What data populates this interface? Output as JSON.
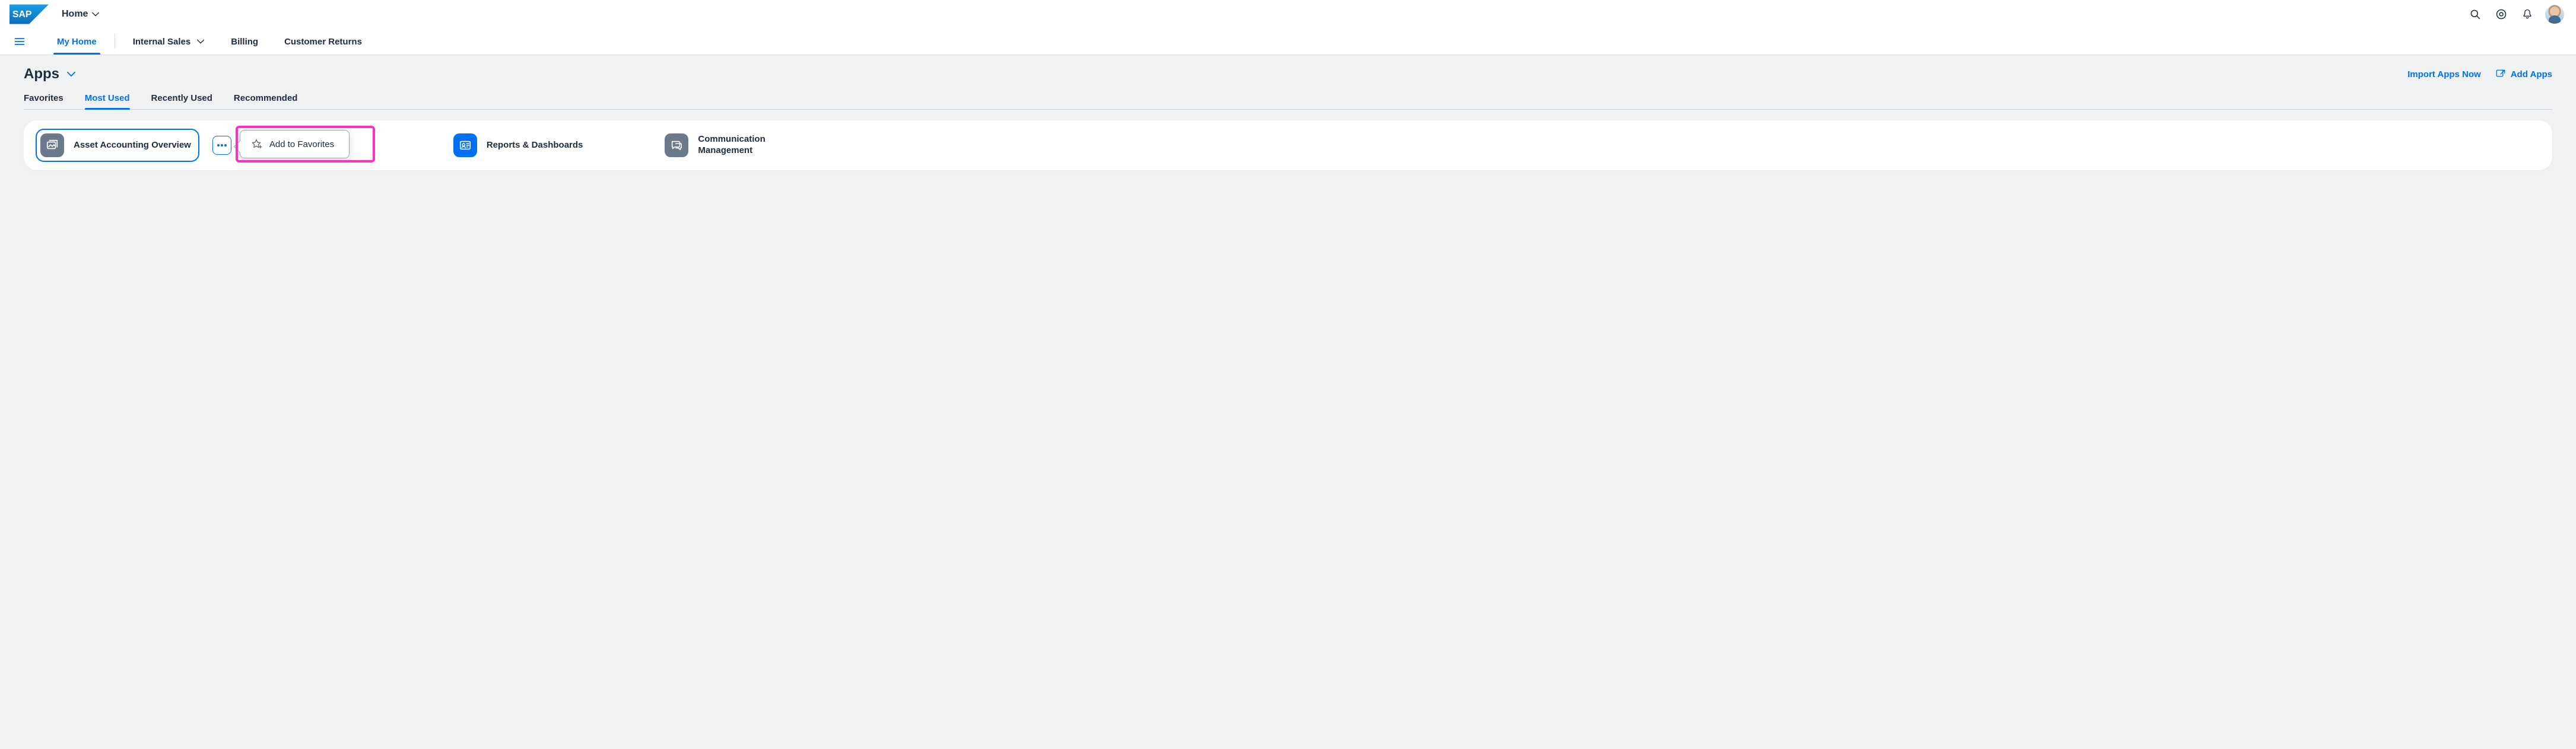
{
  "shell": {
    "title": "Home"
  },
  "nav": {
    "items": [
      {
        "label": "My Home",
        "active": true
      },
      {
        "label": "Internal Sales",
        "dropdown": true
      },
      {
        "label": "Billing"
      },
      {
        "label": "Customer Returns"
      }
    ]
  },
  "page": {
    "title": "Apps",
    "actions": {
      "import": "Import Apps Now",
      "add": "Add Apps"
    },
    "tabs": [
      {
        "label": "Favorites"
      },
      {
        "label": "Most Used",
        "active": true
      },
      {
        "label": "Recently Used"
      },
      {
        "label": "Recommended"
      }
    ]
  },
  "apps": [
    {
      "label": "Asset Accounting Overview",
      "icon": "grey",
      "selected": true
    },
    {
      "label": "Reports & Dashboards",
      "icon": "blue"
    },
    {
      "label": "Communication Management",
      "icon": "grey",
      "twoLine": true
    }
  ],
  "popover": {
    "item": "Add to Favorites"
  }
}
